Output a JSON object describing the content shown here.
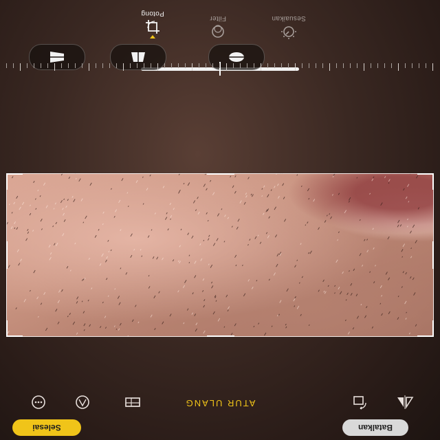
{
  "tabs": [
    {
      "label": "Sesuaikan",
      "icon": "adjust-dial-icon"
    },
    {
      "label": "Filter",
      "icon": "filter-icon"
    },
    {
      "label": "Potong",
      "icon": "crop-rotate-icon"
    }
  ],
  "actions": {
    "cancel_label": "Batalkan",
    "reset_label": "ATUR ULANG",
    "done_label": "Selesai"
  },
  "icons": {
    "flip": "flip-horizontal-icon",
    "rotate": "rotate-icon",
    "aspect": "aspect-ratio-icon",
    "markup": "markup-icon",
    "more": "more-icon"
  },
  "colors": {
    "accent": "#f0c419",
    "cancel_bg": "#d9d9d9"
  }
}
